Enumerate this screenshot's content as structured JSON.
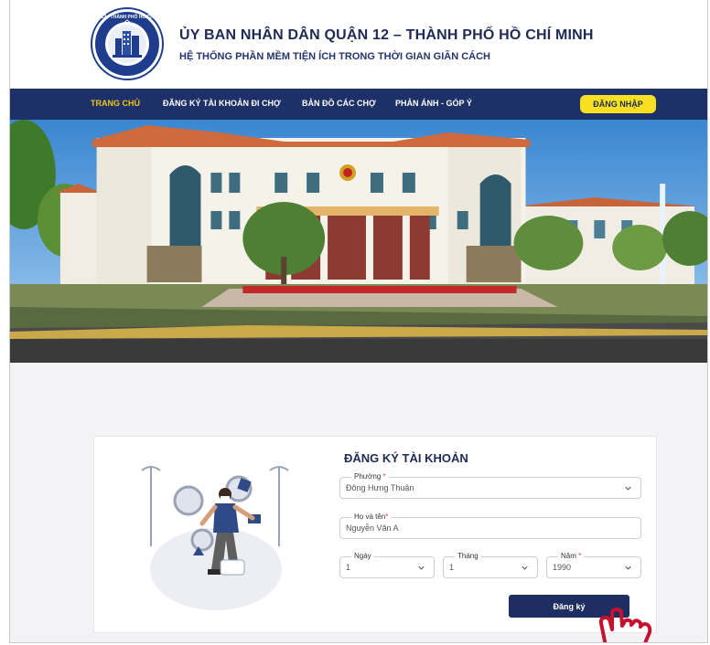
{
  "header": {
    "title": "ỦY BAN NHÂN DÂN QUẬN 12 – THÀNH PHỐ HỒ CHÍ MINH",
    "subtitle": "HỆ THỐNG PHẦN MỀM TIỆN ÍCH TRONG THỜI GIAN GIÃN CÁCH",
    "logo_text": "QUẬN 12 - THÀNH PHỐ HỒ CHÍ MINH"
  },
  "nav": {
    "items": [
      {
        "label": "TRANG CHỦ",
        "active": true
      },
      {
        "label": "ĐĂNG KÝ TÀI KHOẢN ĐI CHỢ",
        "active": false
      },
      {
        "label": "BẢN ĐỒ CÁC CHỢ",
        "active": false
      },
      {
        "label": "PHẢN ÁNH - GÓP Ý",
        "active": false
      }
    ],
    "login_label": "ĐĂNG NHẬP"
  },
  "form": {
    "title": "ĐĂNG KÝ TÀI KHOẢN",
    "ward": {
      "label": "Phường",
      "value": "Đông Hưng Thuận"
    },
    "name": {
      "label": "Họ và tên",
      "value": "Nguyễn Văn A"
    },
    "day": {
      "label": "Ngày",
      "value": "1"
    },
    "month": {
      "label": "Tháng",
      "value": "1"
    },
    "year": {
      "label": "Năm",
      "value": "1990"
    },
    "submit_label": "Đăng ký"
  },
  "colors": {
    "nav_bg": "#1e3068",
    "nav_active": "#f3c617",
    "login_bg": "#f7e021",
    "submit_bg": "#1f2e62",
    "required": "#e33333",
    "cursor": "#c8102e"
  },
  "icons": [
    "district-logo",
    "chevron-down-icon",
    "pointer-hand-icon",
    "shopper-illustration",
    "building-banner"
  ]
}
